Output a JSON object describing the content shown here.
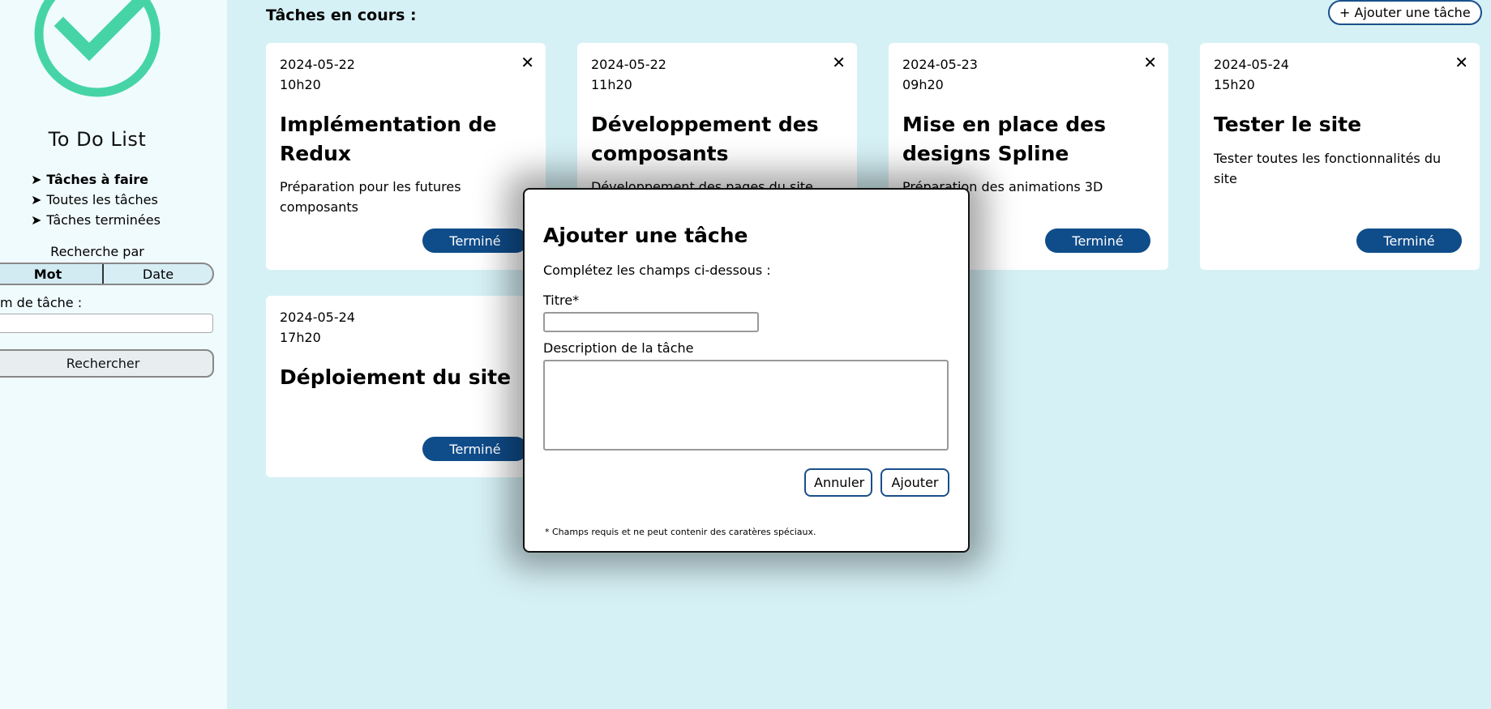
{
  "sidebar": {
    "app_title": "To Do List",
    "nav": [
      {
        "label": "Tâches à faire",
        "active": true
      },
      {
        "label": "Toutes les tâches",
        "active": false
      },
      {
        "label": "Tâches terminées",
        "active": false
      }
    ],
    "nav_arrow": "➤",
    "search_by_label": "Recherche par",
    "modes": [
      "Mot",
      "Date"
    ],
    "selected_mode": "Mot",
    "task_name_label": "m de tâche :",
    "task_name_value": "",
    "search_button": "Rechercher",
    "logo_icon": "check-circle-icon",
    "logo_color": "#46d4a6"
  },
  "main": {
    "section_title": "Tâches en cours :",
    "add_task_button": "+ Ajouter une tâche",
    "close_glyph": "✕",
    "done_label": "Terminé",
    "tasks": [
      {
        "date": "2024-05-22",
        "time": "10h20",
        "title": "Implémentation de Redux",
        "description": "Préparation pour les futures composants"
      },
      {
        "date": "2024-05-22",
        "time": "11h20",
        "title": "Développement des composants",
        "description": "Développement des pages du site"
      },
      {
        "date": "2024-05-23",
        "time": "09h20",
        "title": "Mise en place des designs Spline",
        "description": "Préparation des animations 3D"
      },
      {
        "date": "2024-05-24",
        "time": "15h20",
        "title": "Tester le site",
        "description": "Tester toutes les fonctionnalités du site"
      },
      {
        "date": "2024-05-24",
        "time": "17h20",
        "title": "Déploiement du site",
        "description": ""
      }
    ],
    "colors": {
      "background": "#d6f1f6",
      "button": "#0f4c8a"
    }
  },
  "modal": {
    "title": "Ajouter une tâche",
    "subtitle": "Complétez les champs ci-dessous :",
    "title_label": "Titre*",
    "title_value": "",
    "description_label": "Description de la tâche",
    "description_value": "",
    "cancel_button": "Annuler",
    "add_button": "Ajouter",
    "required_note": "* Champs requis et ne peut contenir des caratères spéciaux."
  }
}
